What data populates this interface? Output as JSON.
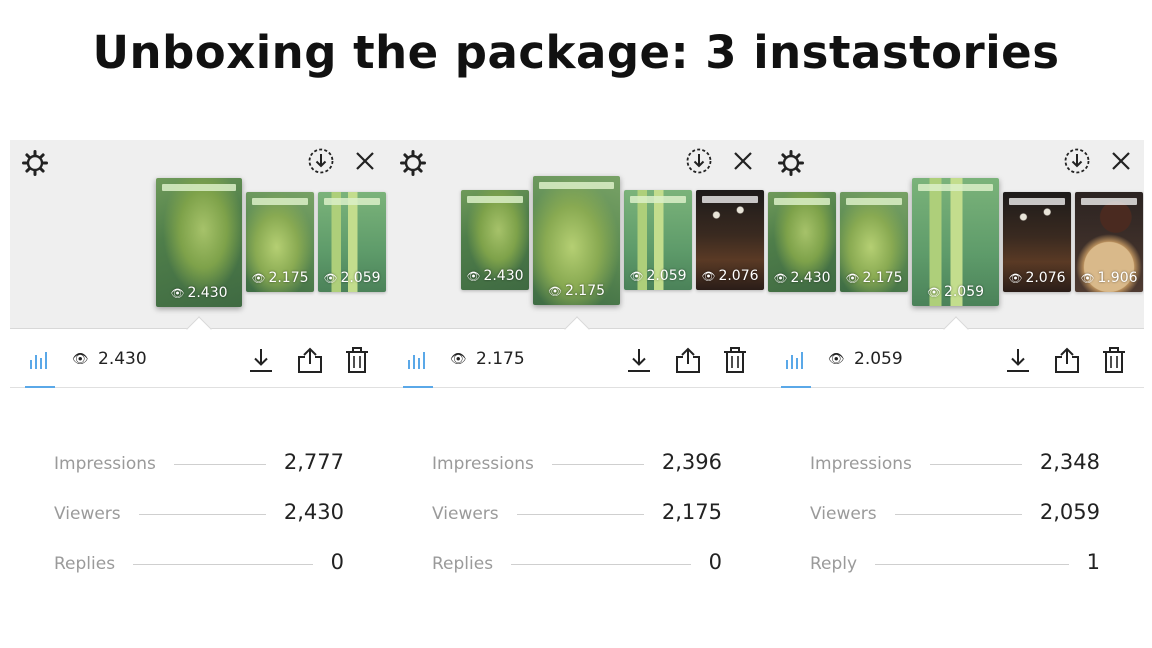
{
  "title": "Unboxing the package: 3 instastories",
  "eye_glyph": "👁",
  "panels": [
    {
      "thumbs": [
        {
          "count": "2.430",
          "art": "green",
          "selected": true
        },
        {
          "count": "2.175",
          "art": "green2",
          "selected": false
        },
        {
          "count": "2.059",
          "art": "product",
          "selected": false
        }
      ],
      "current_views": "2.430",
      "stats": [
        {
          "label": "Impressions",
          "value": "2,777"
        },
        {
          "label": "Viewers",
          "value": "2,430"
        },
        {
          "label": "Replies",
          "value": "0"
        }
      ]
    },
    {
      "thumbs": [
        {
          "count": "2.430",
          "art": "green",
          "selected": false
        },
        {
          "count": "2.175",
          "art": "green2",
          "selected": true
        },
        {
          "count": "2.059",
          "art": "product",
          "selected": false
        },
        {
          "count": "2.076",
          "art": "dark",
          "selected": false
        }
      ],
      "current_views": "2.175",
      "stats": [
        {
          "label": "Impressions",
          "value": "2,396"
        },
        {
          "label": "Viewers",
          "value": "2,175"
        },
        {
          "label": "Replies",
          "value": "0"
        }
      ]
    },
    {
      "thumbs": [
        {
          "count": "2.430",
          "art": "green",
          "selected": false
        },
        {
          "count": "2.175",
          "art": "green2",
          "selected": false
        },
        {
          "count": "2.059",
          "art": "product",
          "selected": true
        },
        {
          "count": "2.076",
          "art": "dark",
          "selected": false
        },
        {
          "count": "1.906",
          "art": "food",
          "selected": false
        }
      ],
      "current_views": "2.059",
      "stats": [
        {
          "label": "Impressions",
          "value": "2,348"
        },
        {
          "label": "Viewers",
          "value": "2,059"
        },
        {
          "label": "Reply",
          "value": "1"
        }
      ]
    }
  ],
  "colors": {
    "accent_tab": "#5aa8e8",
    "strip_bg": "#efefef",
    "stat_label": "#9a9a9a"
  },
  "icons": [
    "gear-icon",
    "download-circle-icon",
    "close-icon",
    "insights-bars-icon",
    "eye-icon",
    "download-icon",
    "share-icon",
    "trash-icon"
  ]
}
